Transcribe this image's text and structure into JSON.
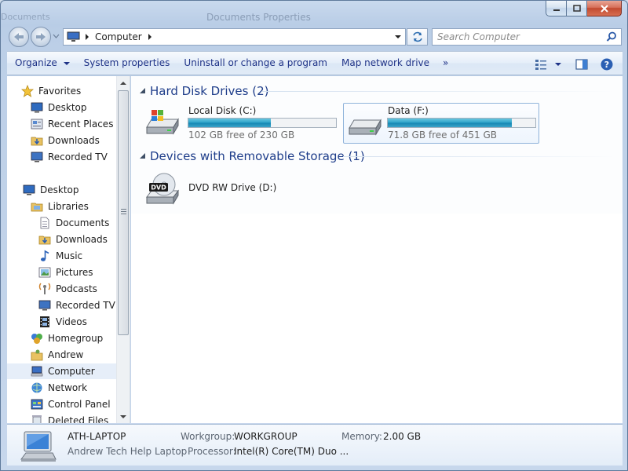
{
  "window": {
    "ghost_title": "Documents Properties",
    "ghost_app": "Documents"
  },
  "address": {
    "crumb": "Computer",
    "search_placeholder": "Search Computer"
  },
  "toolbar": {
    "organize": "Organize",
    "system_properties": "System properties",
    "uninstall": "Uninstall or change a program",
    "map_drive": "Map network drive",
    "more": "»"
  },
  "nav": {
    "favorites": "Favorites",
    "fav_items": [
      "Desktop",
      "Recent Places",
      "Downloads",
      "Recorded TV"
    ],
    "desktop": "Desktop",
    "libraries": "Libraries",
    "lib_items": [
      "Documents",
      "Downloads",
      "Music",
      "Pictures",
      "Podcasts",
      "Recorded TV",
      "Videos"
    ],
    "homegroup": "Homegroup",
    "andrew": "Andrew",
    "computer": "Computer",
    "network": "Network",
    "control_panel": "Control Panel",
    "deleted_files": "Deleted Files"
  },
  "content": {
    "hdd_group": "Hard Disk Drives (2)",
    "removable_group": "Devices with Removable Storage (1)",
    "drives": [
      {
        "name": "Local Disk (C:)",
        "free": "102 GB free of 230 GB",
        "used_fraction": 0.557
      },
      {
        "name": "Data (F:)",
        "free": "71.8 GB free of 451 GB",
        "used_fraction": 0.841
      }
    ],
    "dvd": {
      "name": "DVD RW Drive (D:)",
      "badge": "DVD"
    }
  },
  "details": {
    "computer_name": "ATH-LAPTOP",
    "description": "Andrew Tech Help Laptop",
    "workgroup_label": "Workgroup:",
    "workgroup": "WORKGROUP",
    "memory_label": "Memory:",
    "memory": "2.00 GB",
    "processor_label": "Processor:",
    "processor": "Intel(R) Core(TM) Duo ..."
  },
  "colors": {
    "accent": "#1e3d8a",
    "bar_fill": "#2aa1c8",
    "selection": "#e6eef9"
  }
}
